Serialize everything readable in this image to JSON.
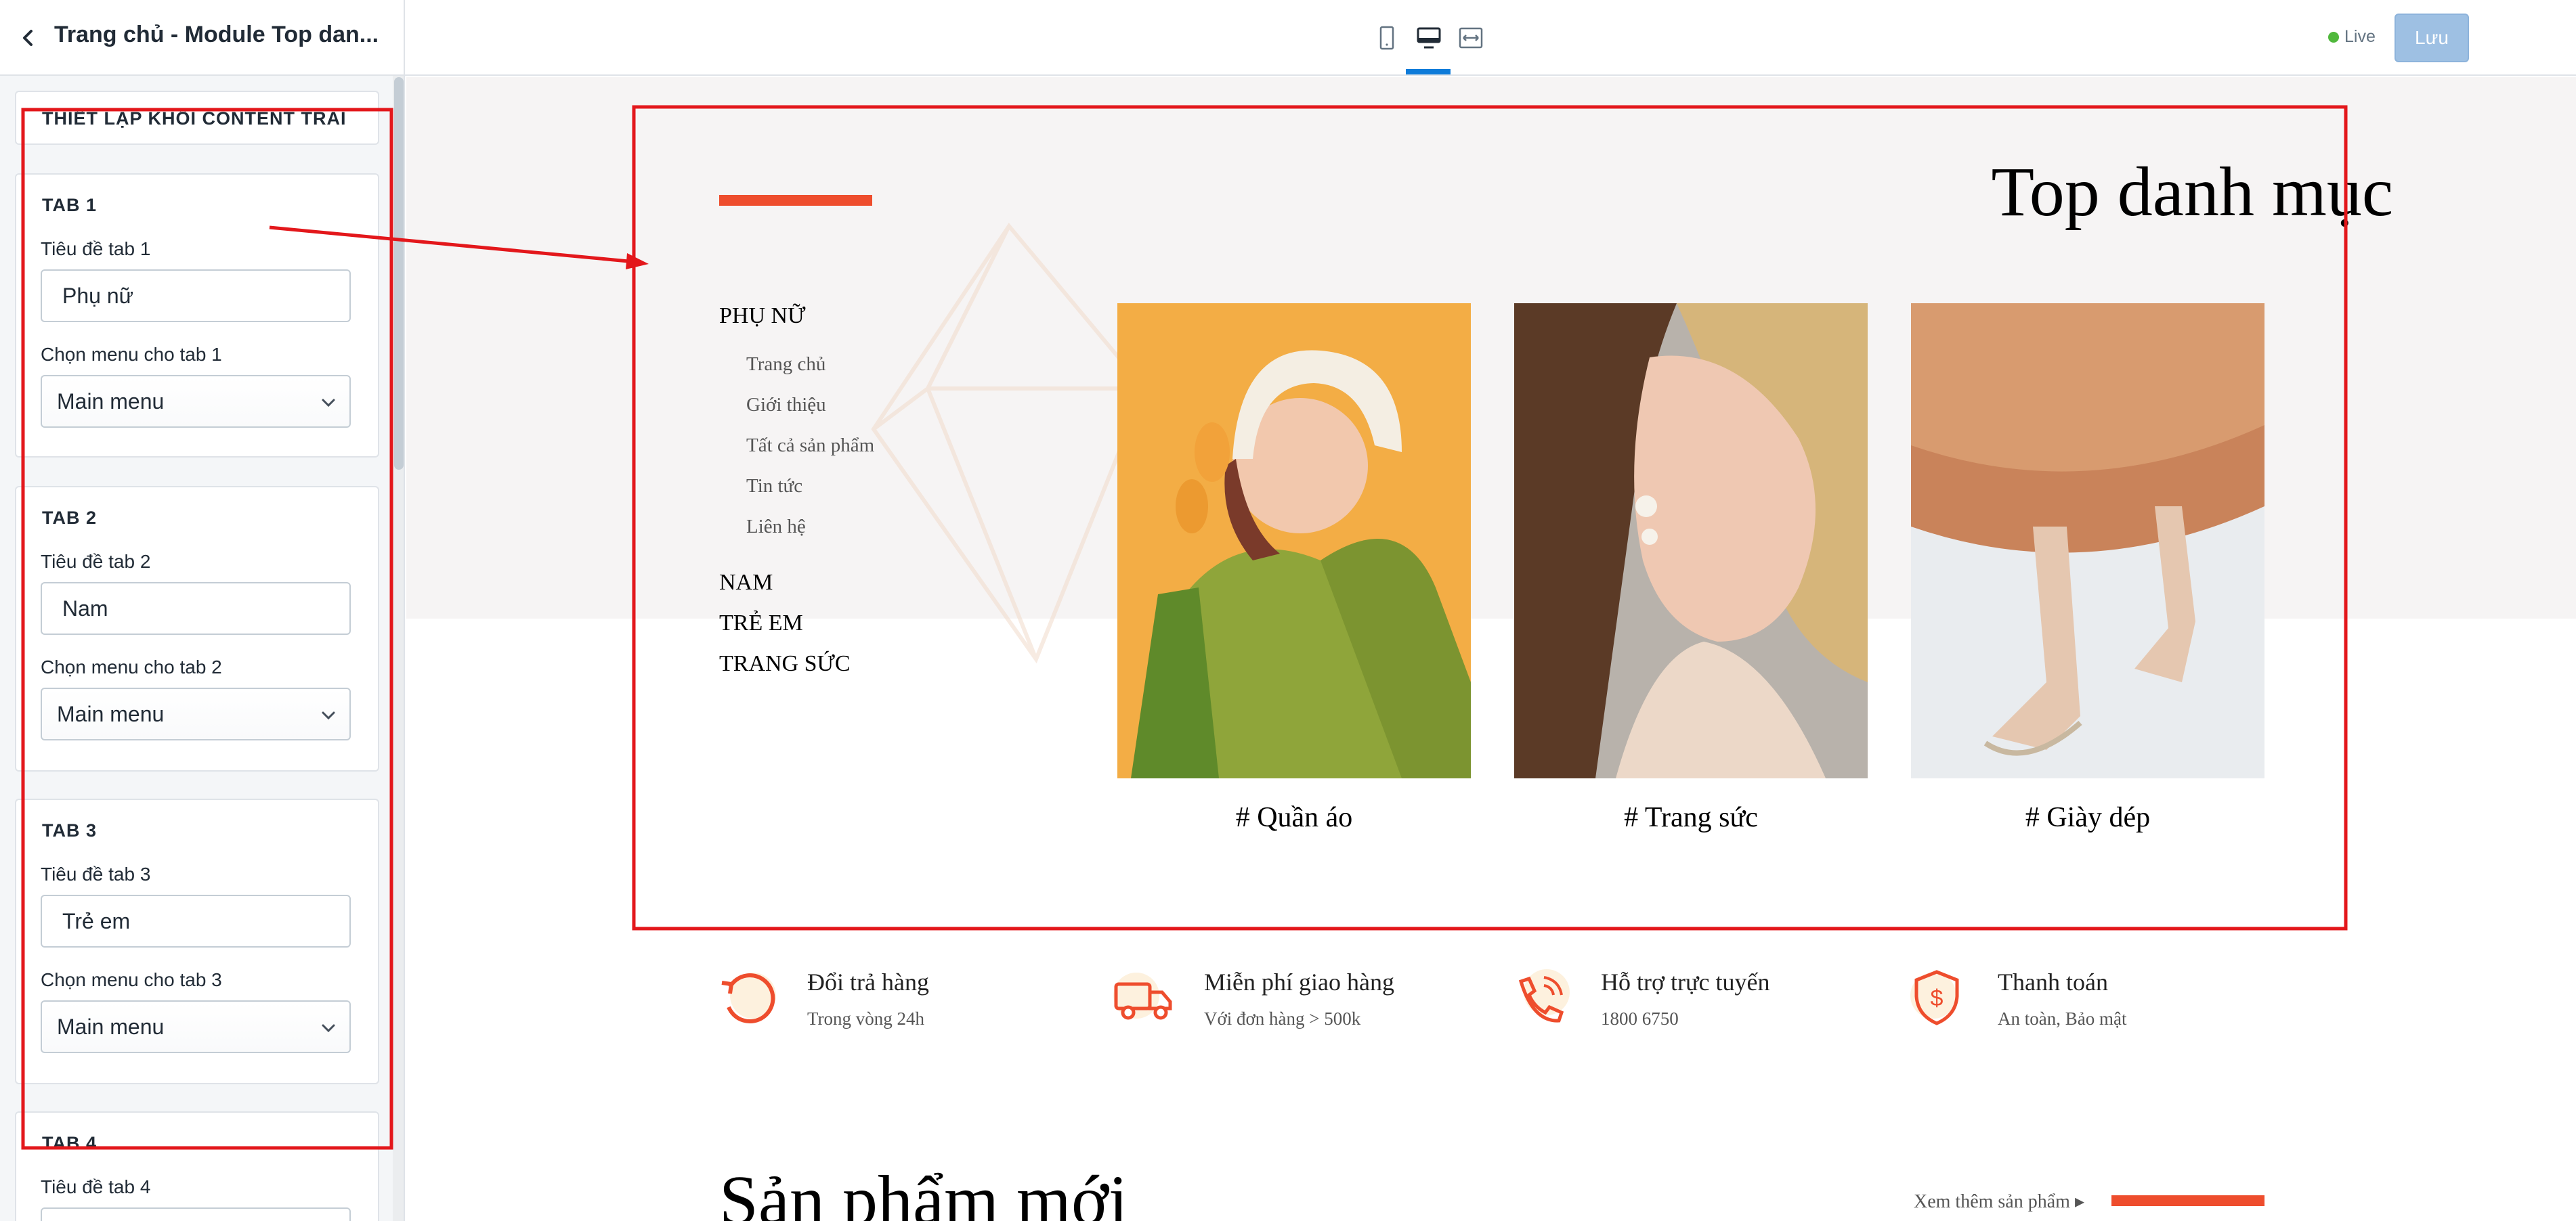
{
  "sidebar": {
    "title": "Trang chủ - Module Top dan...",
    "section_header": "THIẾT LẬP KHỐI CONTENT TRÁI",
    "tabs": [
      {
        "heading": "TAB 1",
        "title_label": "Tiêu đề tab 1",
        "title_value": "Phụ nữ",
        "menu_label": "Chọn menu cho tab 1",
        "menu_value": "Main menu"
      },
      {
        "heading": "TAB 2",
        "title_label": "Tiêu đề tab 2",
        "title_value": "Nam",
        "menu_label": "Chọn menu cho tab 2",
        "menu_value": "Main menu"
      },
      {
        "heading": "TAB 3",
        "title_label": "Tiêu đề tab 3",
        "title_value": "Trẻ em",
        "menu_label": "Chọn menu cho tab 3",
        "menu_value": "Main menu"
      },
      {
        "heading": "TAB 4",
        "title_label": "Tiêu đề tab 4"
      }
    ]
  },
  "topbar": {
    "devices": [
      "mobile-icon",
      "desktop-icon",
      "fullwidth-icon"
    ],
    "active_device": "desktop",
    "live_label": "Live",
    "save_label": "Lưu"
  },
  "preview": {
    "section_title": "Top danh mục",
    "categories": [
      {
        "label": "PHỤ NỮ",
        "submenu": [
          "Trang chủ",
          "Giới thiệu",
          "Tất cả sản phẩm",
          "Tin tức",
          "Liên hệ"
        ]
      },
      {
        "label": "NAM"
      },
      {
        "label": "TRẺ EM"
      },
      {
        "label": "TRANG SỨC"
      }
    ],
    "tiles": [
      {
        "tag": "# Quần áo"
      },
      {
        "tag": "# Trang sức"
      },
      {
        "tag": "# Giày dép"
      }
    ],
    "features": [
      {
        "icon": "return-icon",
        "title": "Đổi trả hàng",
        "subtitle": "Trong vòng 24h"
      },
      {
        "icon": "truck-icon",
        "title": "Miễn phí giao hàng",
        "subtitle": "Với đơn hàng > 500k"
      },
      {
        "icon": "phone-support-icon",
        "title": "Hỗ trợ trực tuyến",
        "subtitle": "1800 6750"
      },
      {
        "icon": "shield-dollar-icon",
        "title": "Thanh toán",
        "subtitle": "An toàn, Bảo mật"
      }
    ],
    "new_products_title": "Sản phẩm mới",
    "more_link": "Xem thêm sản phẩm"
  },
  "colors": {
    "accent": "#ee4d2d",
    "annotation": "#e3171b",
    "save_button": "#9ec0e3",
    "live": "#50b83c",
    "active_tab": "#0e7bd9"
  }
}
